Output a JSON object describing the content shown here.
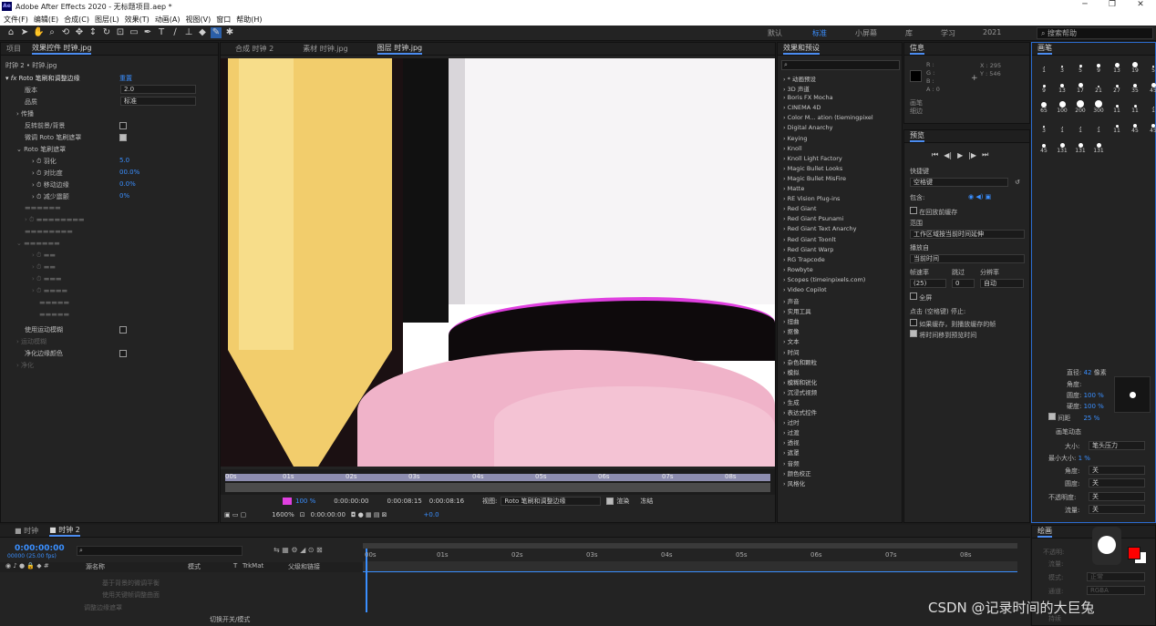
{
  "app": {
    "title": "Adobe After Effects 2020 - 无标题项目.aep *",
    "logo": "Ae"
  },
  "window_controls": {
    "minimize": "─",
    "maximize": "❐",
    "close": "✕"
  },
  "menu": [
    "文件(F)",
    "编辑(E)",
    "合成(C)",
    "图层(L)",
    "效果(T)",
    "动画(A)",
    "视图(V)",
    "窗口",
    "帮助(H)"
  ],
  "workspaces": {
    "default": "默认",
    "standard": "标准",
    "small": "小屏幕",
    "library": "库",
    "learn": "学习",
    "y2021": "2021"
  },
  "search_help": "搜索帮助",
  "project_panel": {
    "tab_project": "项目",
    "tab_effect_controls": "效果控件 时钟.jpg",
    "layer_path": "时钟 2 • 时钟.jpg",
    "effect_name": "Roto 笔刷和调整边缘",
    "reset": "重置",
    "rows": [
      {
        "label": "版本",
        "value": "2.0"
      },
      {
        "label": "品质",
        "value": "标准"
      },
      {
        "label": "传播",
        "value": ""
      },
      {
        "label": "反转前景/背景",
        "value": ""
      },
      {
        "label": "微调 Roto 笔刷遮罩",
        "value": ""
      },
      {
        "label": "Roto 笔刷遮罩",
        "value": ""
      },
      {
        "label": "羽化",
        "value": "5.0"
      },
      {
        "label": "对比度",
        "value": "00.0%"
      },
      {
        "label": "移动边缘",
        "value": "0.0%"
      },
      {
        "label": "减少震颤",
        "value": "0%"
      },
      {
        "label": "使用运动模糊",
        "value": ""
      },
      {
        "label": "运动模糊",
        "value": ""
      },
      {
        "label": "净化边缘颜色",
        "value": ""
      },
      {
        "label": "净化",
        "value": ""
      }
    ]
  },
  "viewer": {
    "tabs": [
      "合成 时钟 2",
      "素材 时钟.jpg",
      "图层 时钟.jpg"
    ],
    "timecodes": [
      "0:00:00:00",
      "0:00:08:15",
      "0:00:08:16"
    ],
    "ruler_marks": [
      "00s",
      "01s",
      "02s",
      "03s",
      "04s",
      "05s",
      "06s",
      "07s",
      "08s"
    ],
    "zoom": "100 %",
    "zoom2": "1600%",
    "view_label": "视图:",
    "view_value": "Roto 笔刷和调整边缘",
    "render": "渲染",
    "freeze": "冻结",
    "time_offset": "+0.0",
    "current_time": "0:00:00:00"
  },
  "effects_panel": {
    "title": "效果和预设",
    "search": "",
    "items": [
      "* 动画预设",
      "3D 声道",
      "Boris FX Mocha",
      "CINEMA 4D",
      "Color M... ation (tiemingpixel",
      "Digital Anarchy",
      "Keying",
      "Knoll",
      "Knoll Light Factory",
      "Magic Bullet Looks",
      "Magic Bullet MisFire",
      "Matte",
      "RE Vision Plug-ins",
      "Red Giant",
      "Red Giant Psunami",
      "Red Giant Text Anarchy",
      "Red Giant Toonlt",
      "Red Giant Warp",
      "RG Trapcode",
      "Rowbyte",
      "Scopes (timeinpixels.com)",
      "Video Copilot",
      "声音",
      "实用工具",
      "扭曲",
      "抠像",
      "文本",
      "时间",
      "杂色和颗粒",
      "模拟",
      "模糊和锐化",
      "沉浸式视频",
      "生成",
      "表达式控件",
      "过时",
      "过渡",
      "透视",
      "遮罩",
      "音频",
      "颜色校正",
      "风格化"
    ]
  },
  "info_panel": {
    "title": "信息",
    "channels": [
      "R :",
      "G :",
      "B :",
      "A : 0"
    ],
    "x": "X : 295",
    "y": "Y : 546",
    "brush_info": [
      "画笔",
      "细边"
    ]
  },
  "preview_panel": {
    "title": "预览",
    "shortcut_label": "快捷键",
    "shortcut_value": "空格键",
    "include_label": "包含:",
    "cache_before": "在回放前缓存",
    "range_label": "范围",
    "range_value": "工作区域按当前时间延伸",
    "play_from_label": "播放自",
    "play_from_value": "当前时间",
    "fps_label": "帧速率",
    "skip_label": "跳过",
    "res_label": "分辨率",
    "fps_value": "(25)",
    "skip_value": "0",
    "res_value": "自动",
    "fullscreen": "全屏",
    "stop_label": "点击 (空格键) 停止:",
    "opt1": "如果缓存，则播放缓存的帧",
    "opt2": "将时间移到预览时间"
  },
  "brushes_panel": {
    "title": "画笔",
    "sizes": [
      "1",
      "3",
      "5",
      "9",
      "13",
      "19",
      "5",
      "9",
      "13",
      "17",
      "21",
      "27",
      "35",
      "45",
      "65",
      "100",
      "200",
      "300",
      "11",
      "11",
      "1",
      "3",
      "1",
      "1",
      "1",
      "11",
      "45",
      "45",
      "45",
      "131",
      "131",
      "131"
    ],
    "diameter_label": "直径:",
    "diameter_value": "42",
    "diameter_unit": "像素",
    "angle_label": "角度:",
    "roundness_label": "圆度:",
    "roundness_value": "100 %",
    "hardness_label": "硬度:",
    "hardness_value": "100 %",
    "spacing_label": "间距",
    "spacing_value": "25 %",
    "dynamics_label": "画笔动态",
    "size_label": "大小:",
    "size_value": "笔头压力",
    "min_size_label": "最小大小:",
    "min_size_value": "1 %",
    "angle2_label": "角度:",
    "angle2_value": "关",
    "roundness2_label": "圆度:",
    "roundness2_value": "关",
    "opacity_label": "不透明度:",
    "opacity_value": "关",
    "flow_label": "流量:",
    "flow_value": "关"
  },
  "paint_panel": {
    "title": "绘画",
    "opacity": "不透明:",
    "flow": "流量:",
    "mode": "模式:",
    "mode_value": "正常",
    "channel": "通道:",
    "channel_value": "RGBA",
    "duration": "持续",
    "fg_color": "#ff0000",
    "bg_color": "#ffffff"
  },
  "timeline": {
    "tabs": [
      "时钟",
      "时钟 2"
    ],
    "time": "0:00:00:00",
    "fps": "00000 (25.00 fps)",
    "col_source": "源名称",
    "col_mode": "模式",
    "col_t": "T",
    "col_trkmat": "TrkMat",
    "col_parent": "父级和链接",
    "rows": [
      "基于背景的微调平衡",
      "使用关键帧调整曲面",
      "调整边缘遮罩"
    ],
    "toggle": "切换开关/模式",
    "ticks": [
      "00s",
      "01s",
      "02s",
      "03s",
      "04s",
      "05s",
      "06s",
      "07s",
      "08s"
    ]
  },
  "watermark": "CSDN @记录时间的大巨兔",
  "colors": {
    "accent": "#3a8fff",
    "panel": "#232323",
    "bg": "#1c1c1c"
  }
}
